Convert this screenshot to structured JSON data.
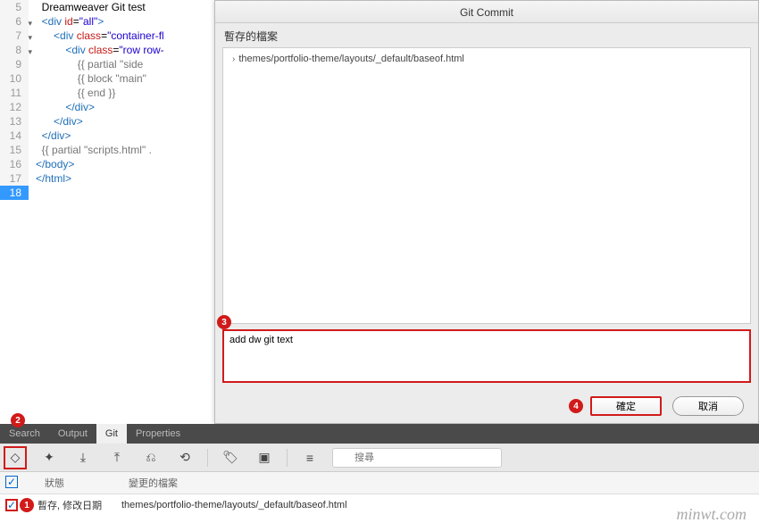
{
  "code": {
    "lines": [
      {
        "n": 5,
        "html": "  Dreamweaver Git test"
      },
      {
        "n": 6,
        "fold": true,
        "html": "  <span class='tag'>&lt;div</span> <span class='attr'>id</span>=<span class='str'>\"all\"</span><span class='tag'>&gt;</span>"
      },
      {
        "n": 7,
        "fold": true,
        "html": "      <span class='tag'>&lt;div</span> <span class='attr'>class</span>=<span class='str'>\"container-fl</span>"
      },
      {
        "n": 8,
        "fold": true,
        "html": "          <span class='tag'>&lt;div</span> <span class='attr'>class</span>=<span class='str'>\"row row-</span>"
      },
      {
        "n": 9,
        "html": "              <span class='tmpl'>{{ partial \"side</span>"
      },
      {
        "n": 10,
        "html": "              <span class='tmpl'>{{ block \"main\" </span>"
      },
      {
        "n": 11,
        "html": "              <span class='tmpl'>{{ end }}</span>"
      },
      {
        "n": 12,
        "html": "          <span class='tag'>&lt;/div&gt;</span>"
      },
      {
        "n": 13,
        "html": "      <span class='tag'>&lt;/div&gt;</span>"
      },
      {
        "n": 14,
        "html": "  <span class='tag'>&lt;/div&gt;</span>"
      },
      {
        "n": 15,
        "html": "  <span class='tmpl'>{{ partial \"scripts.html\" .</span>"
      },
      {
        "n": 16,
        "html": "<span class='tag'>&lt;/body&gt;</span>"
      },
      {
        "n": 17,
        "html": "<span class='tag'>&lt;/html&gt;</span>"
      },
      {
        "n": 18,
        "active": true,
        "html": ""
      }
    ]
  },
  "dialog": {
    "title": "Git Commit",
    "staged_label": "暫存的檔案",
    "staged_item": "themes/portfolio-theme/layouts/_default/baseof.html",
    "commit_msg": "add dw git text",
    "ok": "確定",
    "cancel": "取消"
  },
  "tabs": {
    "search": "Search",
    "output": "Output",
    "git": "Git",
    "properties": "Properties"
  },
  "search_placeholder": "搜尋",
  "file_list": {
    "status_header": "狀態",
    "file_header": "變更的檔案",
    "row_status": "暫存, 修改日期",
    "row_file": "themes/portfolio-theme/layouts/_default/baseof.html"
  },
  "watermark": "minwt.com"
}
